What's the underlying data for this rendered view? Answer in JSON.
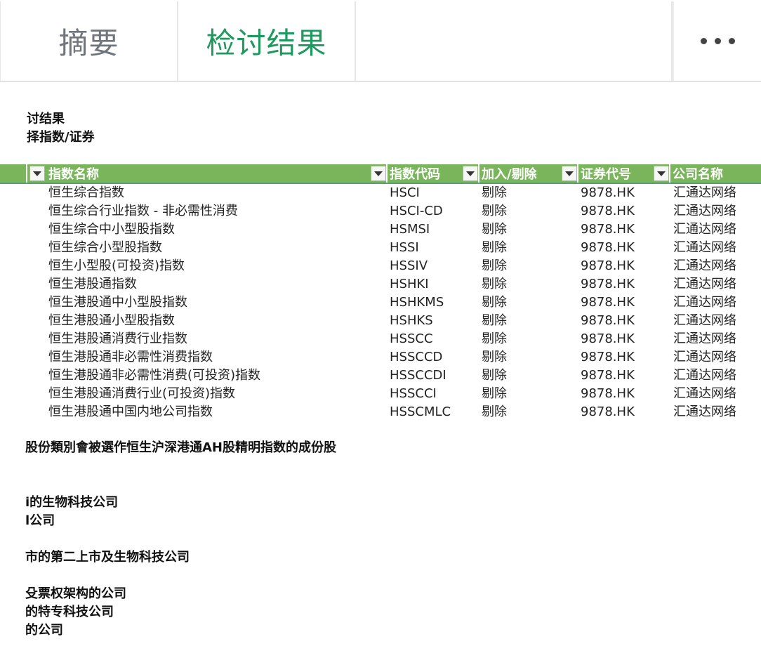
{
  "tabs": [
    {
      "label": "摘要"
    },
    {
      "label": "检讨结果"
    }
  ],
  "more_icon": "more-horizontal-icon",
  "sheet": {
    "heading1": "讨结果",
    "heading2": "择指数/证券"
  },
  "table": {
    "headers": [
      "指数名称",
      "指数代码",
      "加入/剔除",
      "证券代号",
      "公司名称"
    ],
    "rows": [
      [
        "恒生综合指数",
        "HSCI",
        "剔除",
        "9878.HK",
        "汇通达网络"
      ],
      [
        "恒生综合行业指数 - 非必需性消费",
        "HSCI-CD",
        "剔除",
        "9878.HK",
        "汇通达网络"
      ],
      [
        "恒生综合中小型股指数",
        "HSMSI",
        "剔除",
        "9878.HK",
        "汇通达网络"
      ],
      [
        "恒生综合小型股指数",
        "HSSI",
        "剔除",
        "9878.HK",
        "汇通达网络"
      ],
      [
        "恒生小型股(可投资)指数",
        "HSSIV",
        "剔除",
        "9878.HK",
        "汇通达网络"
      ],
      [
        "恒生港股通指数",
        "HSHKI",
        "剔除",
        "9878.HK",
        "汇通达网络"
      ],
      [
        "恒生港股通中小型股指数",
        "HSHKMS",
        "剔除",
        "9878.HK",
        "汇通达网络"
      ],
      [
        "恒生港股通小型股指数",
        "HSHKS",
        "剔除",
        "9878.HK",
        "汇通达网络"
      ],
      [
        "恒生港股通消费行业指数",
        "HSSCC",
        "剔除",
        "9878.HK",
        "汇通达网络"
      ],
      [
        "恒生港股通非必需性消费指数",
        "HSSCCD",
        "剔除",
        "9878.HK",
        "汇通达网络"
      ],
      [
        "恒生港股通非必需性消费(可投资)指数",
        "HSSCCDI",
        "剔除",
        "9878.HK",
        "汇通达网络"
      ],
      [
        "恒生港股通消费行业(可投资)指数",
        "HSSCCI",
        "剔除",
        "9878.HK",
        "汇通达网络"
      ],
      [
        "恒生港股通中国内地公司指数",
        "HSSCMLC",
        "剔除",
        "9878.HK",
        "汇通达网络"
      ]
    ]
  },
  "notes": [
    "股份類別會被選作恒生沪深港通AH股精明指数的成份股",
    "i的生物科技公司",
    "l公司",
    "市的第二上市及生物科技公司",
    "殳票权架构的公司",
    "的特专科技公司",
    "的公司"
  ],
  "colors": {
    "accent": "#1e9a5f",
    "header_bg": "#7ab55c"
  }
}
